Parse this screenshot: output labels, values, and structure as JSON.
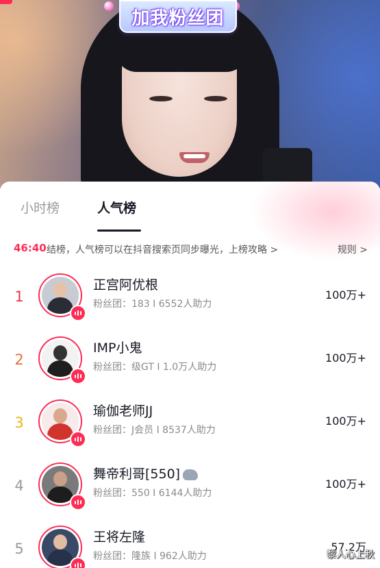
{
  "stream": {
    "sticker_text": "加我粉丝团"
  },
  "tabs": [
    {
      "label": "小时榜",
      "active": false
    },
    {
      "label": "人气榜",
      "active": true
    }
  ],
  "notice": {
    "timer": "46:40",
    "message": "结榜，人气榜可以在抖音搜索页同步曝光，上榜攻略 >",
    "rules_label": "规则 >"
  },
  "ranking": [
    {
      "rank": "1",
      "rank_color": "#e8344e",
      "name": "正宫阿优根",
      "sub": "粉丝团：183 I 6552人助力",
      "score": "100万+"
    },
    {
      "rank": "2",
      "rank_color": "#e8703a",
      "name": "IMP小鬼",
      "sub": "粉丝团：级GT I 1.0万人助力",
      "score": "100万+"
    },
    {
      "rank": "3",
      "rank_color": "#e8b418",
      "name": "瑜伽老师JJ",
      "sub": "粉丝团：J会员 I 8537人助力",
      "score": "100万+"
    },
    {
      "rank": "4",
      "rank_color": "#9a9a9a",
      "name": "舞帝利哥[550]",
      "sub": "粉丝团：550 I 6144人助力",
      "score": "100万+"
    },
    {
      "rank": "5",
      "rank_color": "#9a9a9a",
      "name": "王将左隆",
      "sub": "粉丝团：隆族 I 962人助力",
      "score": "57.2万"
    }
  ],
  "watermark": "黎人心上秋",
  "colors": {
    "accent": "#fe2c55",
    "text_primary": "#161823",
    "text_secondary": "#8a8a8a"
  }
}
